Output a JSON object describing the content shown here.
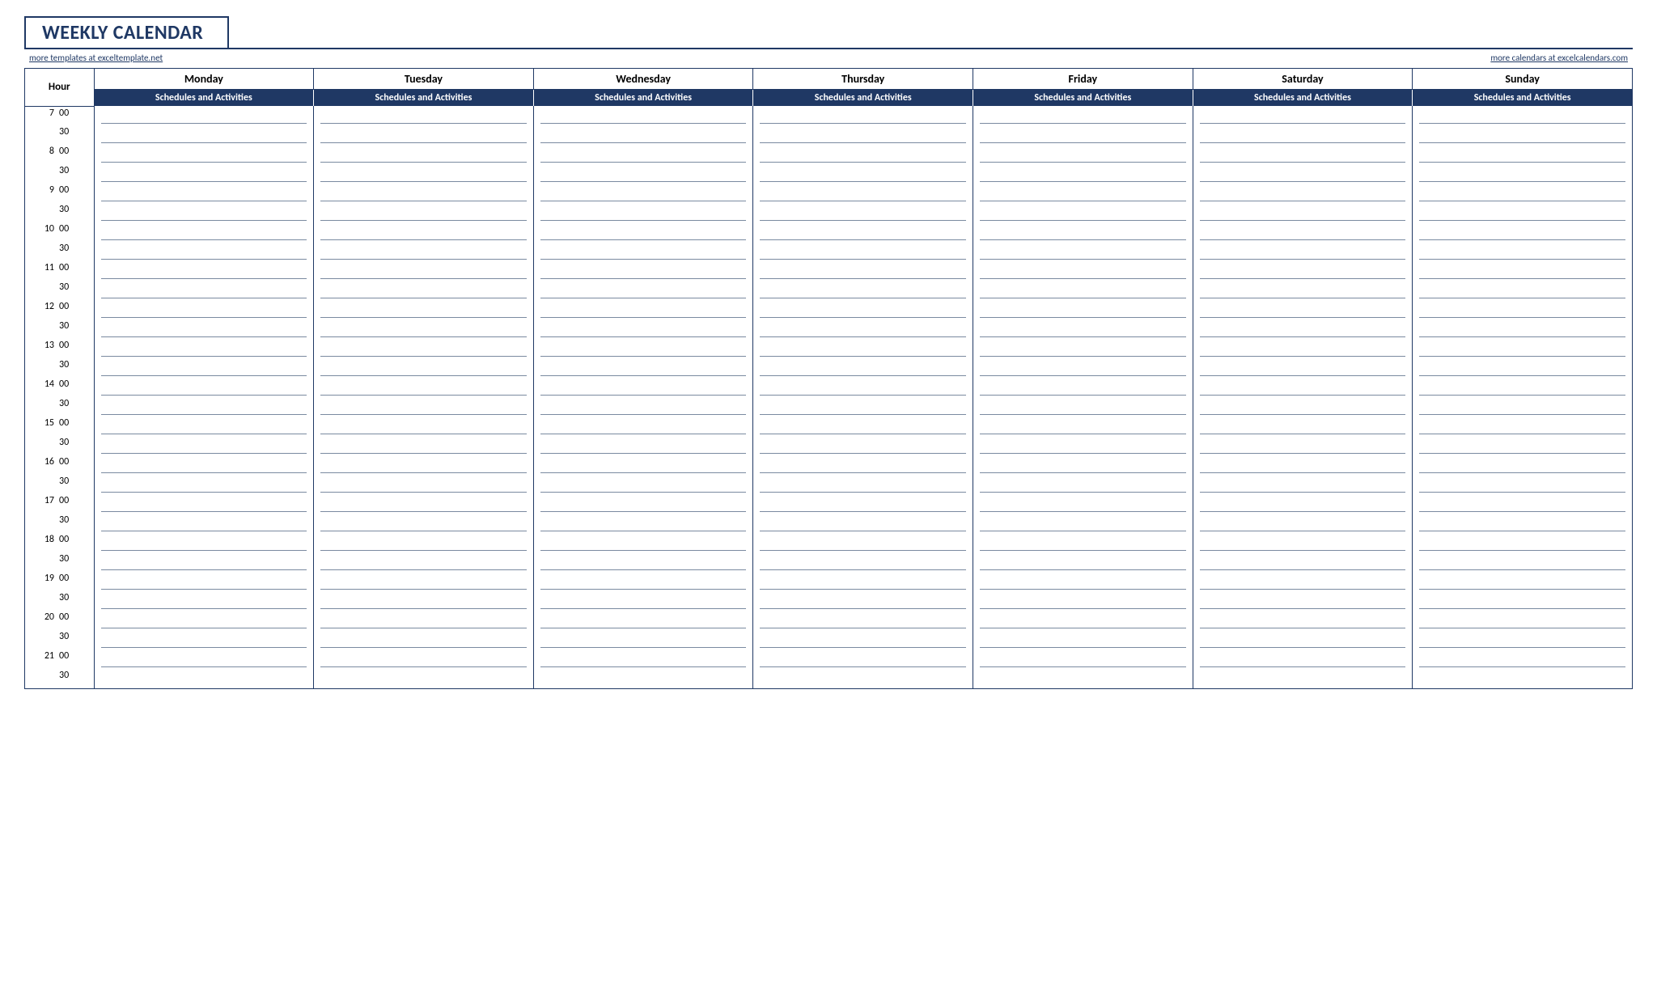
{
  "title": "WEEKLY CALENDAR",
  "links": {
    "left": "more templates at exceltemplate.net",
    "right": "more calendars at excelcalendars.com"
  },
  "hour_label": "Hour",
  "subheader_label": "Schedules and Activities",
  "days": [
    "Monday",
    "Tuesday",
    "Wednesday",
    "Thursday",
    "Friday",
    "Saturday",
    "Sunday"
  ],
  "time_slots": [
    {
      "hour": "7",
      "minute": "00"
    },
    {
      "hour": "",
      "minute": "30"
    },
    {
      "hour": "8",
      "minute": "00"
    },
    {
      "hour": "",
      "minute": "30"
    },
    {
      "hour": "9",
      "minute": "00"
    },
    {
      "hour": "",
      "minute": "30"
    },
    {
      "hour": "10",
      "minute": "00"
    },
    {
      "hour": "",
      "minute": "30"
    },
    {
      "hour": "11",
      "minute": "00"
    },
    {
      "hour": "",
      "minute": "30"
    },
    {
      "hour": "12",
      "minute": "00"
    },
    {
      "hour": "",
      "minute": "30"
    },
    {
      "hour": "13",
      "minute": "00"
    },
    {
      "hour": "",
      "minute": "30"
    },
    {
      "hour": "14",
      "minute": "00"
    },
    {
      "hour": "",
      "minute": "30"
    },
    {
      "hour": "15",
      "minute": "00"
    },
    {
      "hour": "",
      "minute": "30"
    },
    {
      "hour": "16",
      "minute": "00"
    },
    {
      "hour": "",
      "minute": "30"
    },
    {
      "hour": "17",
      "minute": "00"
    },
    {
      "hour": "",
      "minute": "30"
    },
    {
      "hour": "18",
      "minute": "00"
    },
    {
      "hour": "",
      "minute": "30"
    },
    {
      "hour": "19",
      "minute": "00"
    },
    {
      "hour": "",
      "minute": "30"
    },
    {
      "hour": "20",
      "minute": "00"
    },
    {
      "hour": "",
      "minute": "30"
    },
    {
      "hour": "21",
      "minute": "00"
    },
    {
      "hour": "",
      "minute": "30"
    }
  ],
  "colors": {
    "brand_navy": "#1f3864",
    "rule_line": "#7a8aa0"
  }
}
